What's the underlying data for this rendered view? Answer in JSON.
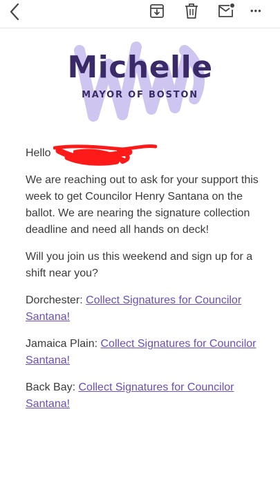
{
  "toolbar": {
    "icons": [
      "back-icon",
      "archive-icon",
      "delete-icon",
      "mark-unread-icon",
      "more-icon"
    ],
    "more_label": "•••"
  },
  "header": {
    "name": "Michelle",
    "subtitle": "MAYOR OF BOSTON",
    "brand_color": "#3a2a67",
    "scribble_color": "#c9c0ef"
  },
  "email": {
    "greeting": "Hello",
    "paragraph1": "We are reaching out to ask for your support this week to get Councilor Henry Santana on the ballot. We are nearing the signature collection deadline and need all hands on deck!",
    "paragraph2": "Will you join us this weekend and sign up for a shift near you?",
    "locations": [
      {
        "label": "Dorchester:",
        "link": "Collect Signatures for Councilor Santana!"
      },
      {
        "label": "Jamaica Plain:",
        "link": "Collect Signatures for Councilor Santana!"
      },
      {
        "label": "Back Bay:",
        "link": "Collect Signatures for Councilor Santana!"
      }
    ],
    "link_color": "#6a4fb4",
    "redaction_color": "#ff1a1a"
  }
}
